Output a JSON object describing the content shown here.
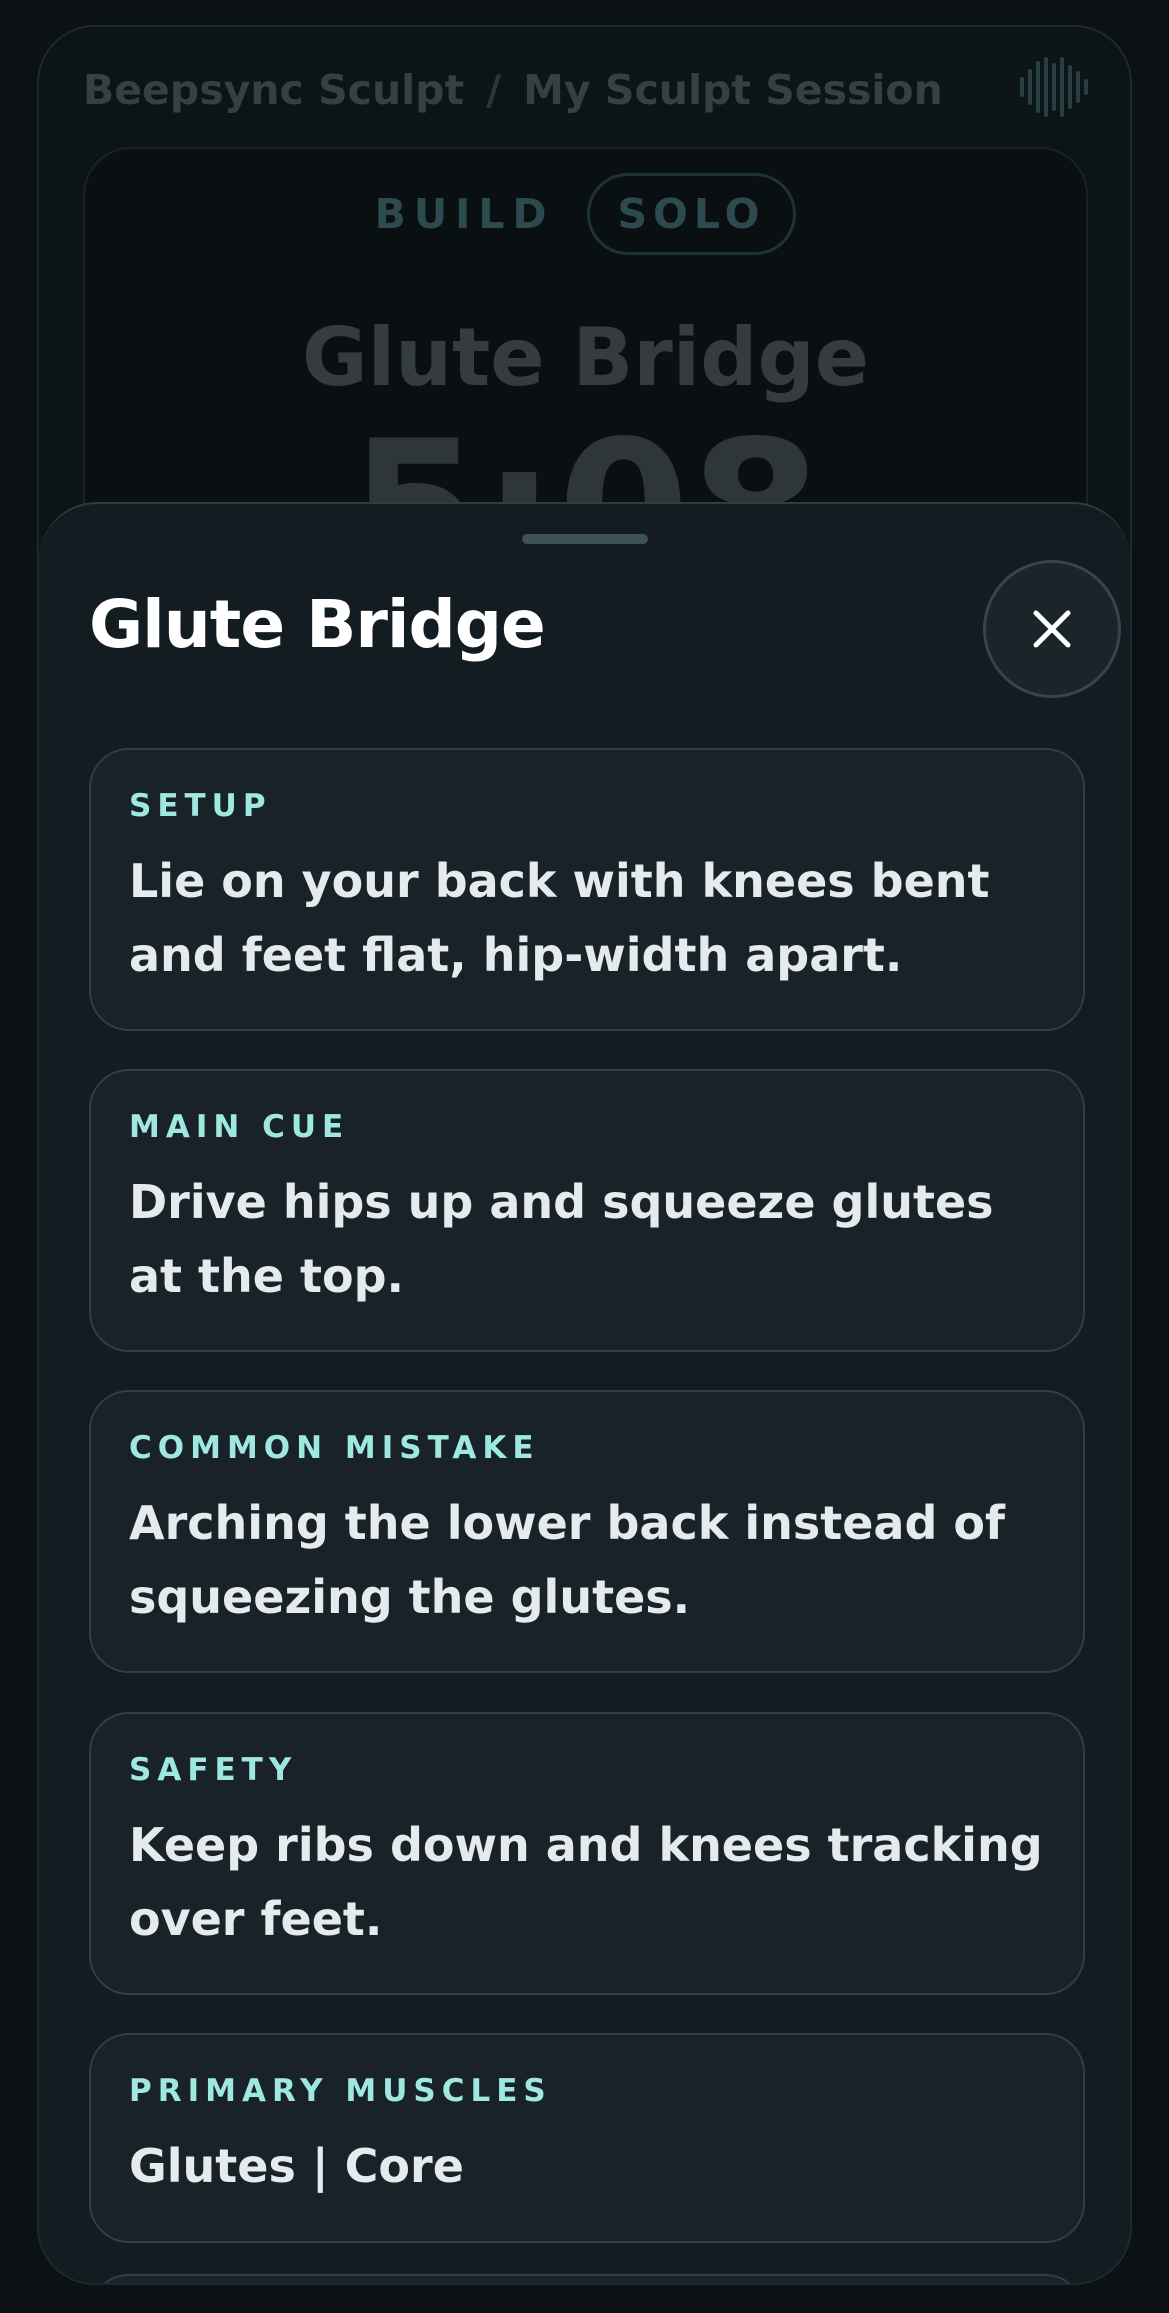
{
  "breadcrumb": {
    "app": "Beepsync Sculpt",
    "separator": "/",
    "session": "My Sculpt Session"
  },
  "session_card": {
    "phase": "BUILD",
    "mode": "SOLO",
    "exercise": "Glute Bridge",
    "timer": "5:08"
  },
  "sheet": {
    "title": "Glute Bridge",
    "close_icon": "close-icon",
    "cards": [
      {
        "label": "SETUP",
        "text": "Lie on your back with knees bent and feet flat, hip-width apart."
      },
      {
        "label": "MAIN CUE",
        "text": "Drive hips up and squeeze glutes at the top."
      },
      {
        "label": "COMMON MISTAKE",
        "text": "Arching the lower back instead of squeezing the glutes."
      },
      {
        "label": "SAFETY",
        "text": "Keep ribs down and knees tracking over feet."
      },
      {
        "label": "PRIMARY MUSCLES",
        "text": "Glutes | Core"
      }
    ]
  },
  "colors": {
    "accent": "#9ee8e1",
    "background": "#0b1114",
    "sheet": "#131c21",
    "card": "#182228"
  }
}
